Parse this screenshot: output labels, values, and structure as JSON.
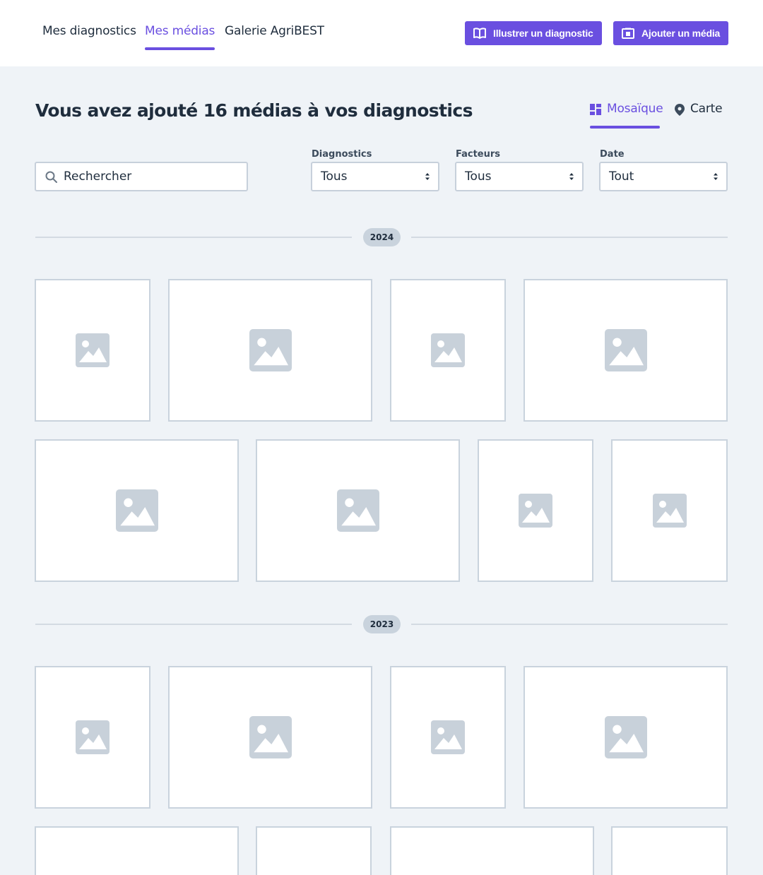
{
  "nav": {
    "tabs": [
      {
        "label": "Mes diagnostics",
        "active": false
      },
      {
        "label": "Mes médias",
        "active": true
      },
      {
        "label": "Galerie AgriBEST",
        "active": false
      }
    ],
    "actions": {
      "illustrate_label": "Illustrer un diagnostic",
      "illustrate_icon": "book-open-icon",
      "add_media_label": "Ajouter un média",
      "add_media_icon": "photo-add-icon"
    }
  },
  "main": {
    "title": "Vous avez ajouté 16 médias à vos diagnostics",
    "views": [
      {
        "label": "Mosaïque",
        "icon": "grid-icon",
        "active": true
      },
      {
        "label": "Carte",
        "icon": "map-pin-icon",
        "active": false
      }
    ]
  },
  "filters": {
    "search_placeholder": "Rechercher",
    "diagnostics": {
      "label": "Diagnostics",
      "value": "Tous"
    },
    "factors": {
      "label": "Facteurs",
      "value": "Tous"
    },
    "date": {
      "label": "Date",
      "value": "Tout"
    }
  },
  "groups": [
    {
      "year": "2024",
      "media_count": 8
    },
    {
      "year": "2023",
      "media_count": 8
    }
  ],
  "colors": {
    "accent": "#6a4fe0",
    "background": "#eff3f7",
    "border": "#c9d3dd",
    "placeholder_icon": "#c8d1da"
  }
}
